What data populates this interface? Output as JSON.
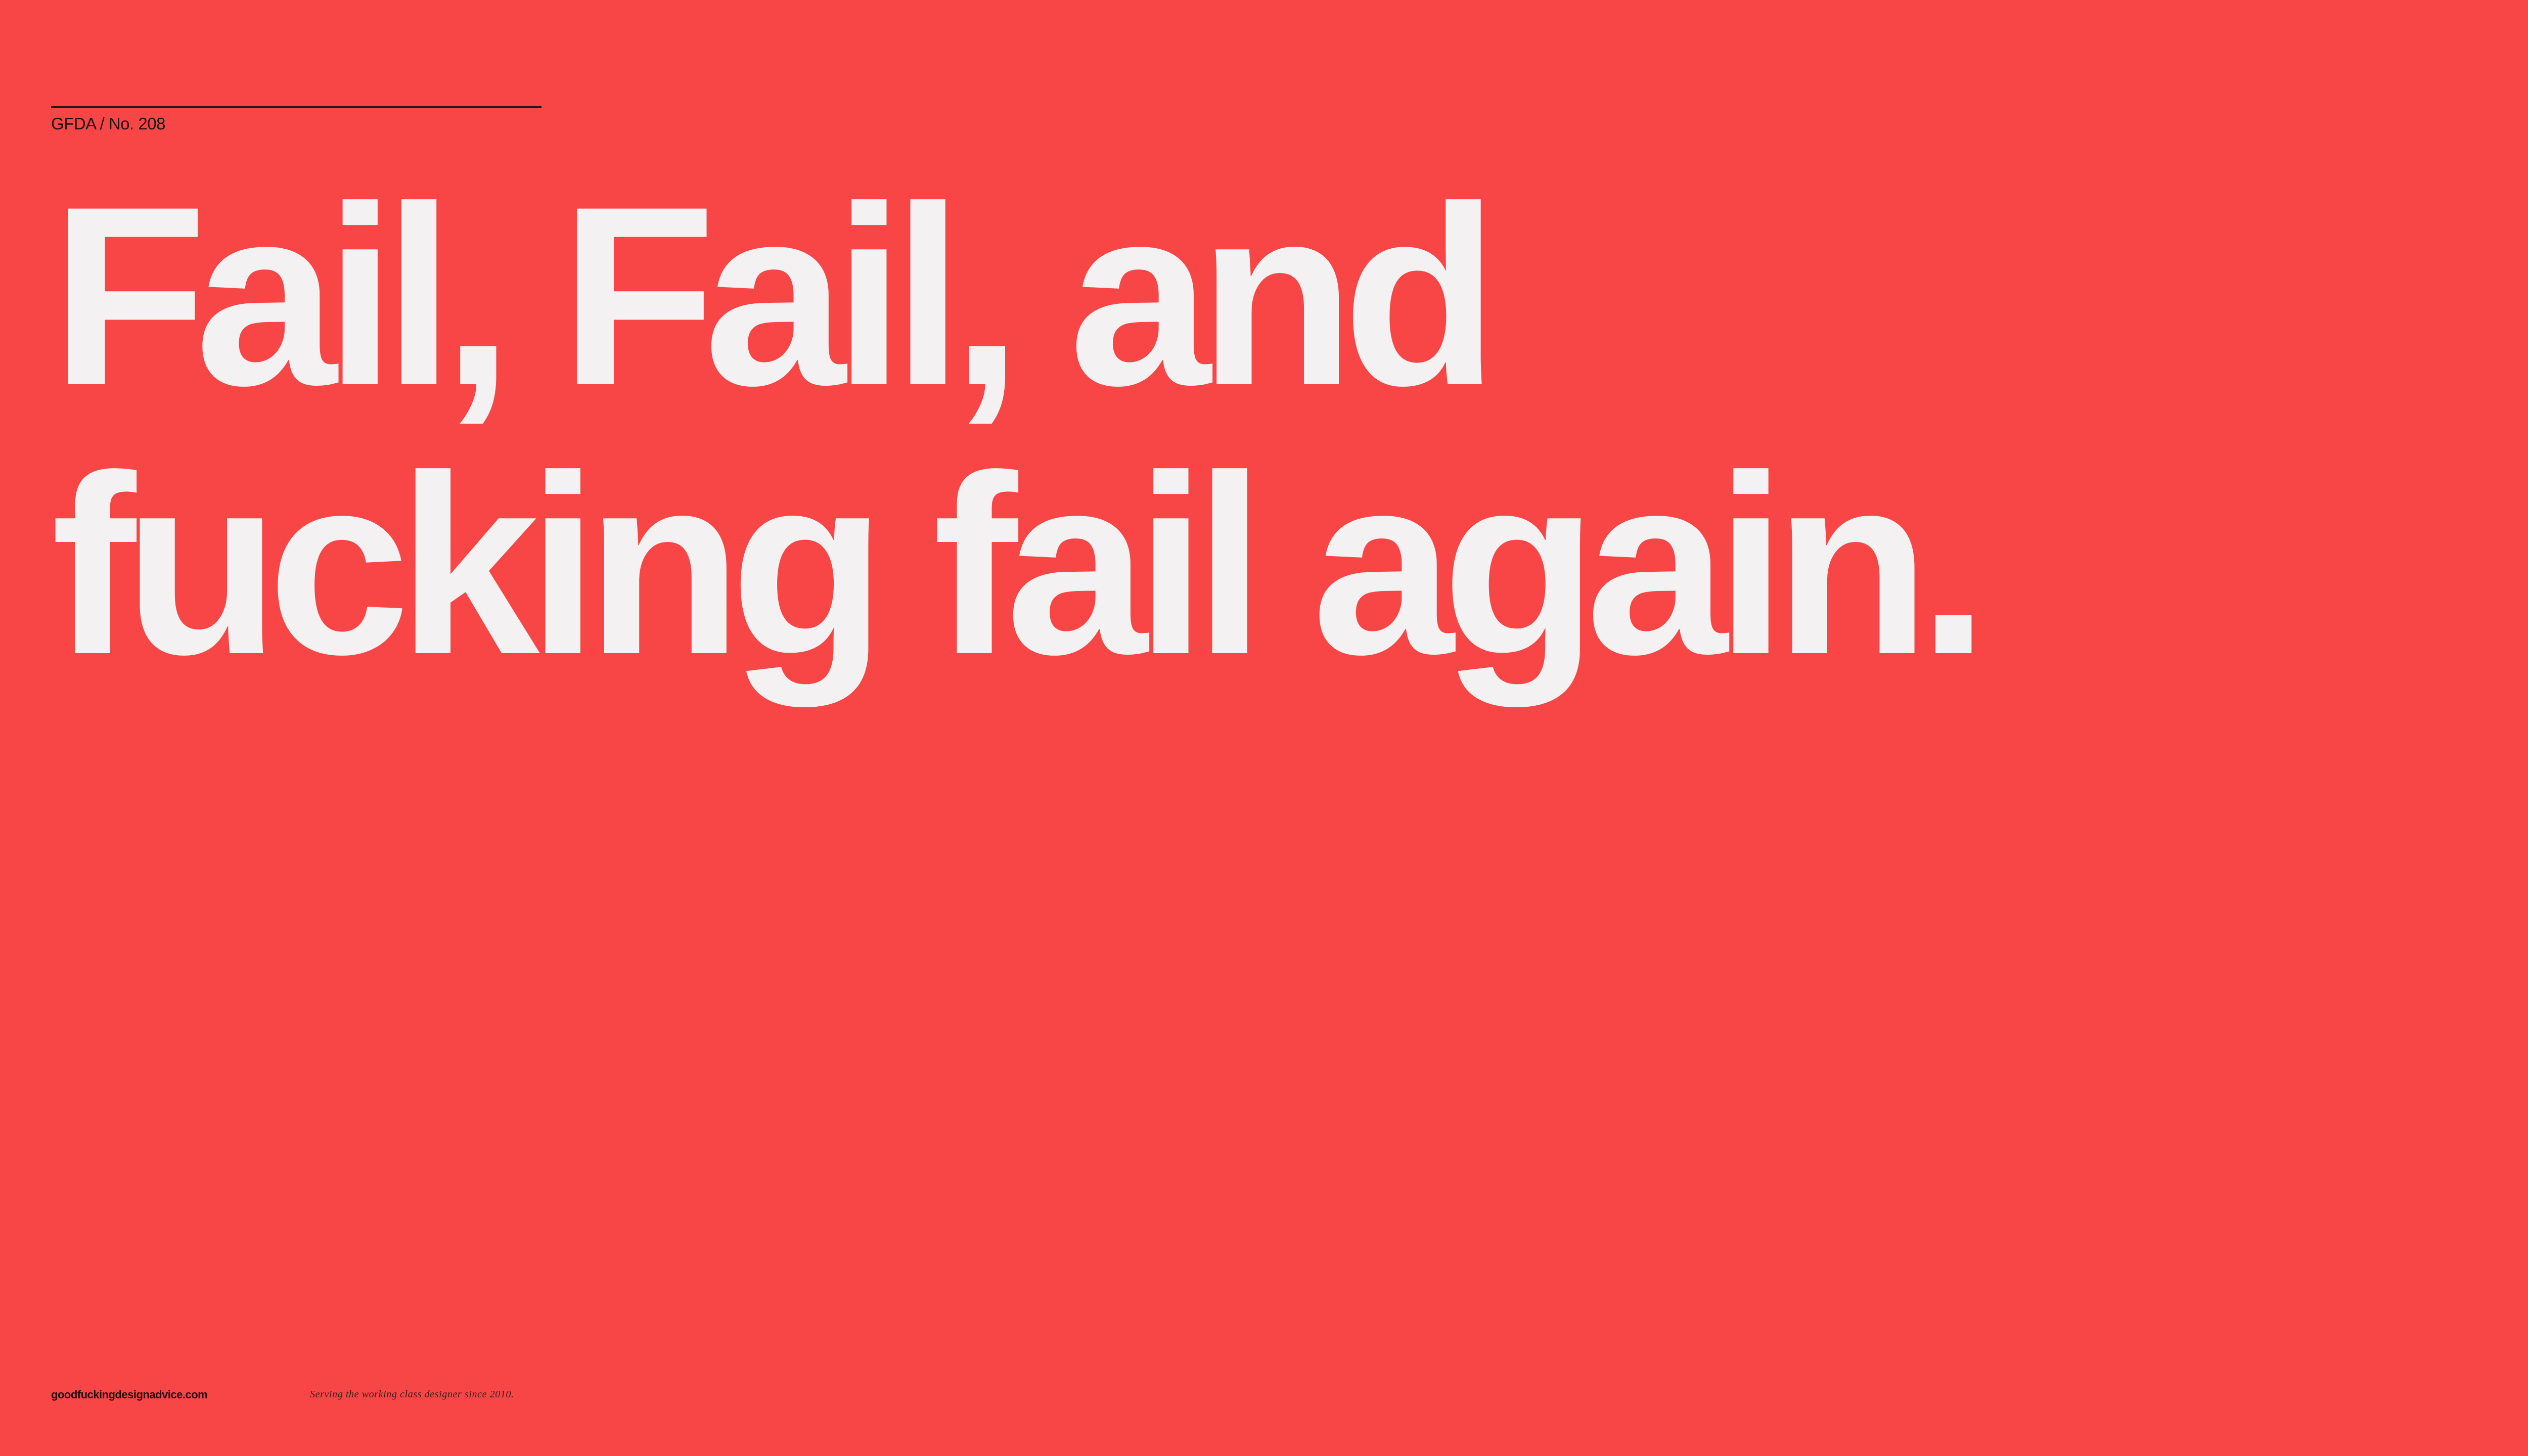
{
  "header": {
    "issue_label": "GFDA / No. 208"
  },
  "headline": {
    "line1": "Fail, Fail, and",
    "line2": "fucking fail again."
  },
  "footer": {
    "site_link": "goodfuckingdesignadvice.com",
    "tagline": "Serving the working class designer since 2010."
  },
  "colors": {
    "background": "#F84545",
    "headline_text": "#F3F1F1",
    "small_text": "#1d1010"
  }
}
